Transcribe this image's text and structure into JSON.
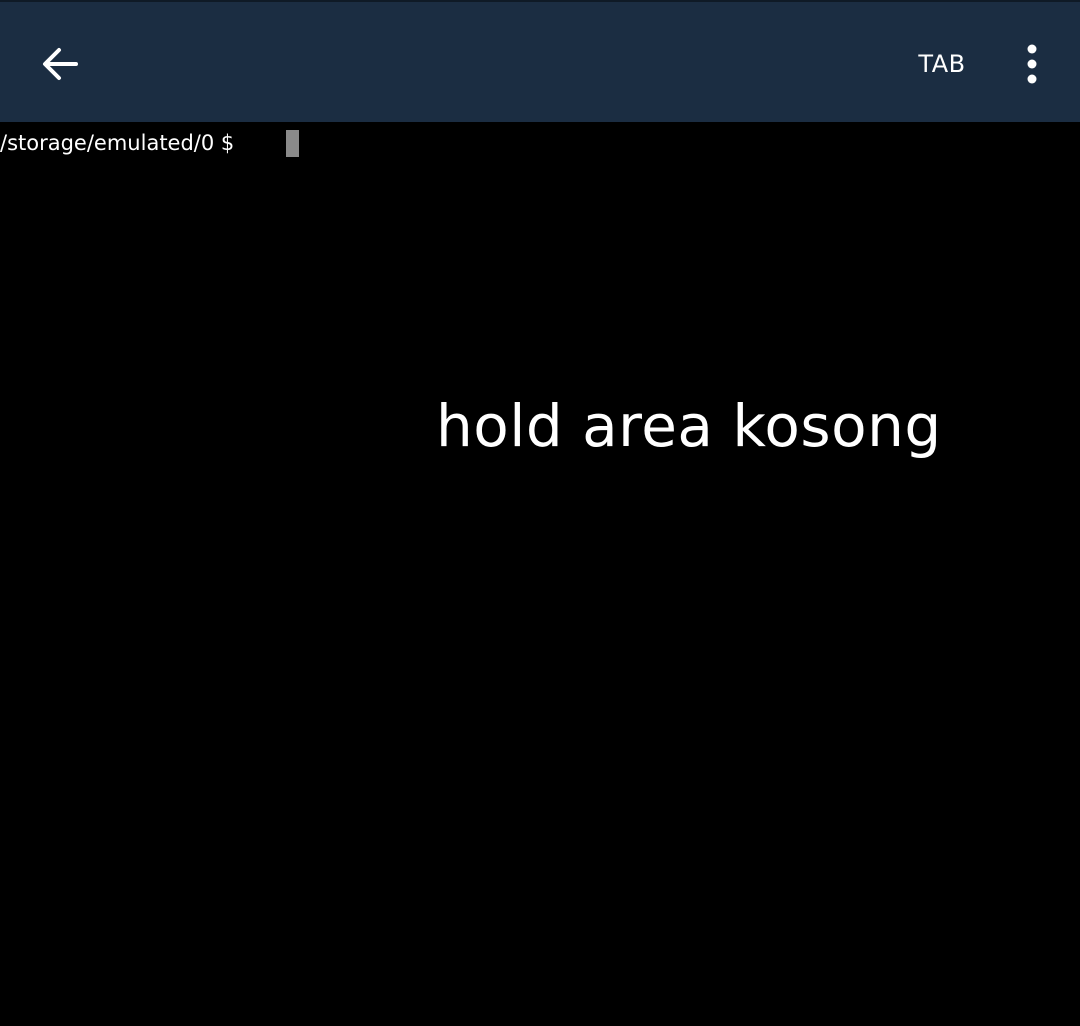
{
  "app_bar": {
    "back_icon": "arrow-left-icon",
    "tab_label": "TAB",
    "more_icon": "more-vertical-icon",
    "background": "#1b2d42"
  },
  "terminal": {
    "prompt": "/storage/emulated/0 $",
    "cursor_color": "#8a8a8a",
    "background": "#000000"
  },
  "overlay": {
    "hint": "hold area kosong"
  }
}
